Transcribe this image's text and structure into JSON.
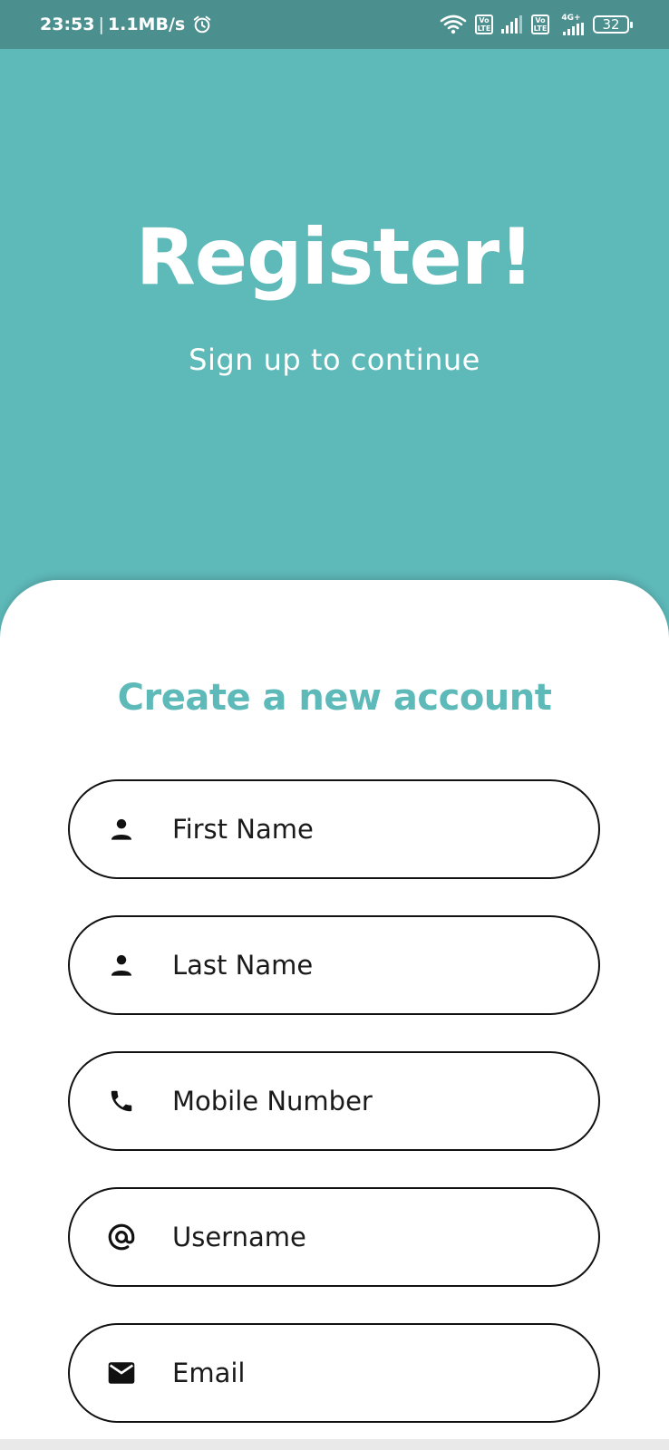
{
  "status_bar": {
    "time": "23:53",
    "separator": "|",
    "speed": "1.1MB/s",
    "volte_1": "Vo LTE",
    "volte_2": "Vo LTE",
    "network_type": "4G+",
    "battery": "32"
  },
  "header": {
    "title": "Register!",
    "subtitle": "Sign up to continue"
  },
  "form": {
    "title": "Create a new account",
    "fields": [
      {
        "placeholder": "First Name",
        "icon": "person-icon"
      },
      {
        "placeholder": "Last Name",
        "icon": "person-icon"
      },
      {
        "placeholder": "Mobile Number",
        "icon": "phone-icon"
      },
      {
        "placeholder": "Username",
        "icon": "at-icon"
      },
      {
        "placeholder": "Email",
        "icon": "mail-icon"
      }
    ]
  },
  "colors": {
    "accent": "#5eb9b9",
    "status_bar": "#4b8f8e"
  }
}
